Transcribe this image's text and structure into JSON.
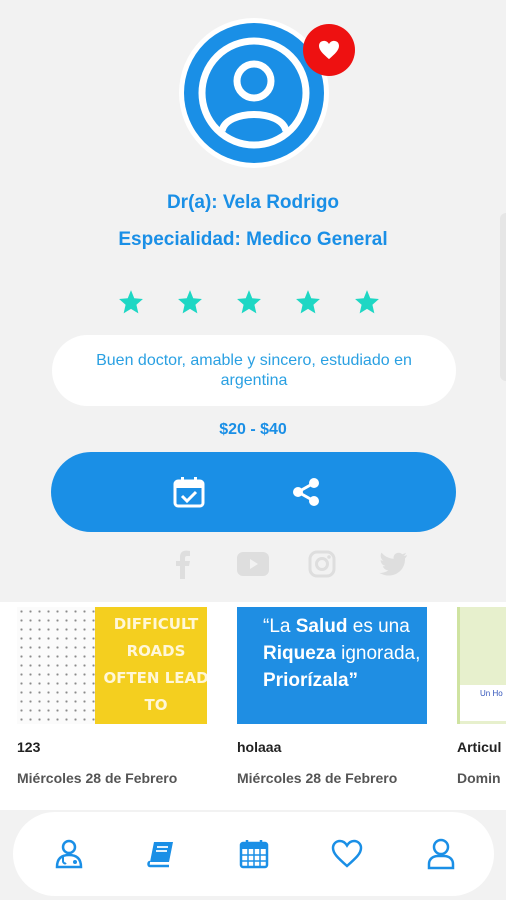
{
  "doctor": {
    "name": "Dr(a): Vela Rodrigo",
    "specialty": "Especialidad: Medico General",
    "rating": 5,
    "rating_max": 5,
    "description": "Buen doctor, amable y sincero, estudiado en argentina",
    "price": "$20 - $40"
  },
  "icons": {
    "avatar": "user-icon",
    "favorite": "heart-icon",
    "star": "star-icon",
    "schedule": "calendar-check-icon",
    "share": "share-icon",
    "social": [
      "facebook-icon",
      "youtube-icon",
      "instagram-icon",
      "twitter-icon"
    ]
  },
  "colors": {
    "primary": "#1a8fe6",
    "star": "#1ed7c4",
    "favorite_badge": "#ee1111",
    "social_disabled": "#dedede"
  },
  "articles": [
    {
      "title": "123",
      "date": "Miércoles 28 de Febrero",
      "image_text": "DIFFICULT ROADS OFTEN LEAD TO BEAUTIFUL DESTINATIONS"
    },
    {
      "title": "holaaa",
      "date": "Miércoles 28 de Febrero",
      "image_text_parts": [
        "“La ",
        "Salud",
        " es una ",
        "Riqueza",
        " ignorada, ",
        "Priorízala",
        "”"
      ]
    },
    {
      "title": "Articul",
      "date": "Domin",
      "image_text": "Un Ho"
    }
  ],
  "nav": {
    "items": [
      {
        "name": "doctor-icon",
        "active": true
      },
      {
        "name": "book-icon",
        "active": false
      },
      {
        "name": "calendar-icon",
        "active": false
      },
      {
        "name": "heart-outline-icon",
        "active": false
      },
      {
        "name": "profile-icon",
        "active": false
      }
    ]
  }
}
